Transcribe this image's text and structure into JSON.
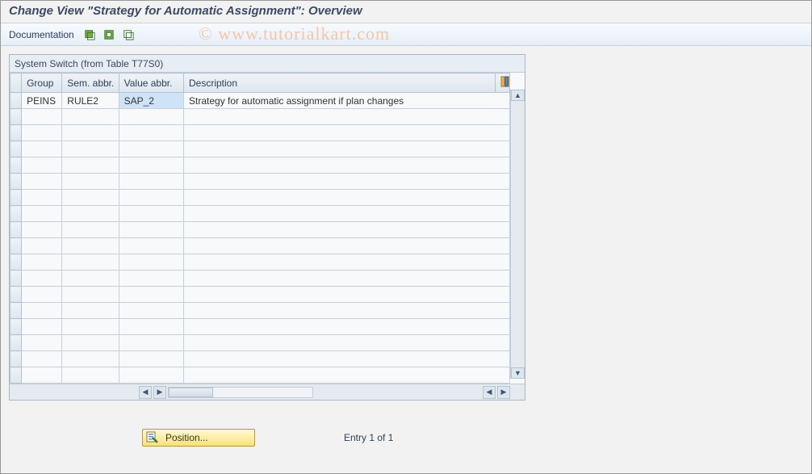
{
  "title": "Change View \"Strategy for Automatic Assignment\": Overview",
  "watermark": "© www.tutorialkart.com",
  "toolbar": {
    "documentation_label": "Documentation",
    "icons": [
      "select-all-icon",
      "select-block-icon",
      "deselect-all-icon"
    ]
  },
  "group": {
    "caption": "System Switch (from Table T77S0)",
    "columns": {
      "group": "Group",
      "sem": "Sem. abbr.",
      "val": "Value abbr.",
      "desc": "Description"
    },
    "rows": [
      {
        "group": "PEINS",
        "sem": "RULE2",
        "val": "SAP_2",
        "desc": "Strategy for automatic assignment if plan changes",
        "val_active": true
      }
    ],
    "empty_row_count": 17
  },
  "footer": {
    "position_label": "Position...",
    "entry_text": "Entry 1 of 1"
  }
}
